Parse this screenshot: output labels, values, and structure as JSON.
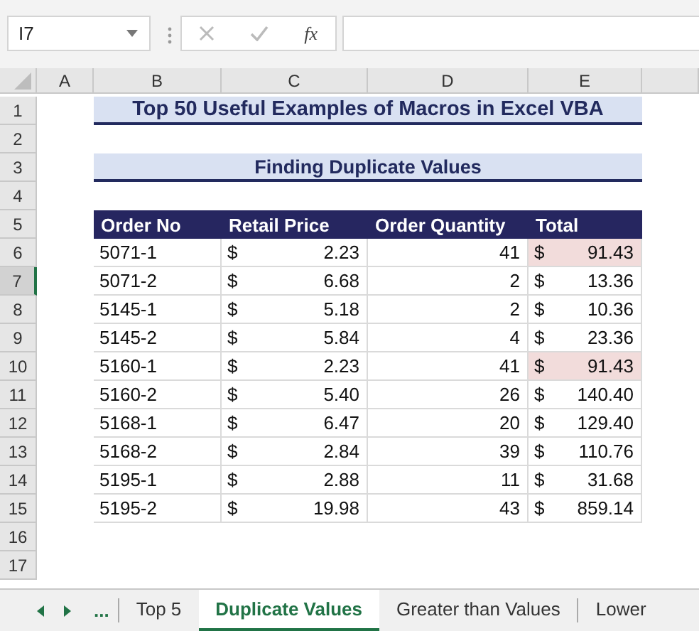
{
  "name_box": {
    "value": "I7"
  },
  "formula_bar": {
    "function_label": "fx"
  },
  "column_headers": [
    {
      "label": "A"
    },
    {
      "label": "B"
    },
    {
      "label": "C"
    },
    {
      "label": "D"
    },
    {
      "label": "E"
    }
  ],
  "row_headers": [
    {
      "label": "1",
      "selected": false
    },
    {
      "label": "2",
      "selected": false
    },
    {
      "label": "3",
      "selected": false
    },
    {
      "label": "4",
      "selected": false
    },
    {
      "label": "5",
      "selected": false
    },
    {
      "label": "6",
      "selected": false
    },
    {
      "label": "7",
      "selected": true
    },
    {
      "label": "8",
      "selected": false
    },
    {
      "label": "9",
      "selected": false
    },
    {
      "label": "10",
      "selected": false
    },
    {
      "label": "11",
      "selected": false
    },
    {
      "label": "12",
      "selected": false
    },
    {
      "label": "13",
      "selected": false
    },
    {
      "label": "14",
      "selected": false
    },
    {
      "label": "15",
      "selected": false
    },
    {
      "label": "16",
      "selected": false
    },
    {
      "label": "17",
      "selected": false
    }
  ],
  "title": "Top 50 Useful Examples of Macros in Excel VBA",
  "subtitle": "Finding Duplicate Values",
  "table": {
    "columns": [
      "Order No",
      "Retail Price",
      "Order Quantity",
      "Total"
    ],
    "rows": [
      {
        "order_no": "5071-1",
        "price_currency": "$",
        "price": "2.23",
        "quantity": "41",
        "total_currency": "$",
        "total": "91.43",
        "duplicate": true
      },
      {
        "order_no": "5071-2",
        "price_currency": "$",
        "price": "6.68",
        "quantity": "2",
        "total_currency": "$",
        "total": "13.36",
        "duplicate": false
      },
      {
        "order_no": "5145-1",
        "price_currency": "$",
        "price": "5.18",
        "quantity": "2",
        "total_currency": "$",
        "total": "10.36",
        "duplicate": false
      },
      {
        "order_no": "5145-2",
        "price_currency": "$",
        "price": "5.84",
        "quantity": "4",
        "total_currency": "$",
        "total": "23.36",
        "duplicate": false
      },
      {
        "order_no": "5160-1",
        "price_currency": "$",
        "price": "2.23",
        "quantity": "41",
        "total_currency": "$",
        "total": "91.43",
        "duplicate": true
      },
      {
        "order_no": "5160-2",
        "price_currency": "$",
        "price": "5.40",
        "quantity": "26",
        "total_currency": "$",
        "total": "140.40",
        "duplicate": false
      },
      {
        "order_no": "5168-1",
        "price_currency": "$",
        "price": "6.47",
        "quantity": "20",
        "total_currency": "$",
        "total": "129.40",
        "duplicate": false
      },
      {
        "order_no": "5168-2",
        "price_currency": "$",
        "price": "2.84",
        "quantity": "39",
        "total_currency": "$",
        "total": "110.76",
        "duplicate": false
      },
      {
        "order_no": "5195-1",
        "price_currency": "$",
        "price": "2.88",
        "quantity": "11",
        "total_currency": "$",
        "total": "31.68",
        "duplicate": false
      },
      {
        "order_no": "5195-2",
        "price_currency": "$",
        "price": "19.98",
        "quantity": "43",
        "total_currency": "$",
        "total": "859.14",
        "duplicate": false
      }
    ]
  },
  "sheet_tabs": {
    "overflow": "...",
    "tabs": [
      {
        "label": "Top 5",
        "selected": false
      },
      {
        "label": "Duplicate Values",
        "selected": true
      },
      {
        "label": "Greater than Values",
        "selected": false
      },
      {
        "label": "Lower",
        "selected": false
      }
    ]
  }
}
